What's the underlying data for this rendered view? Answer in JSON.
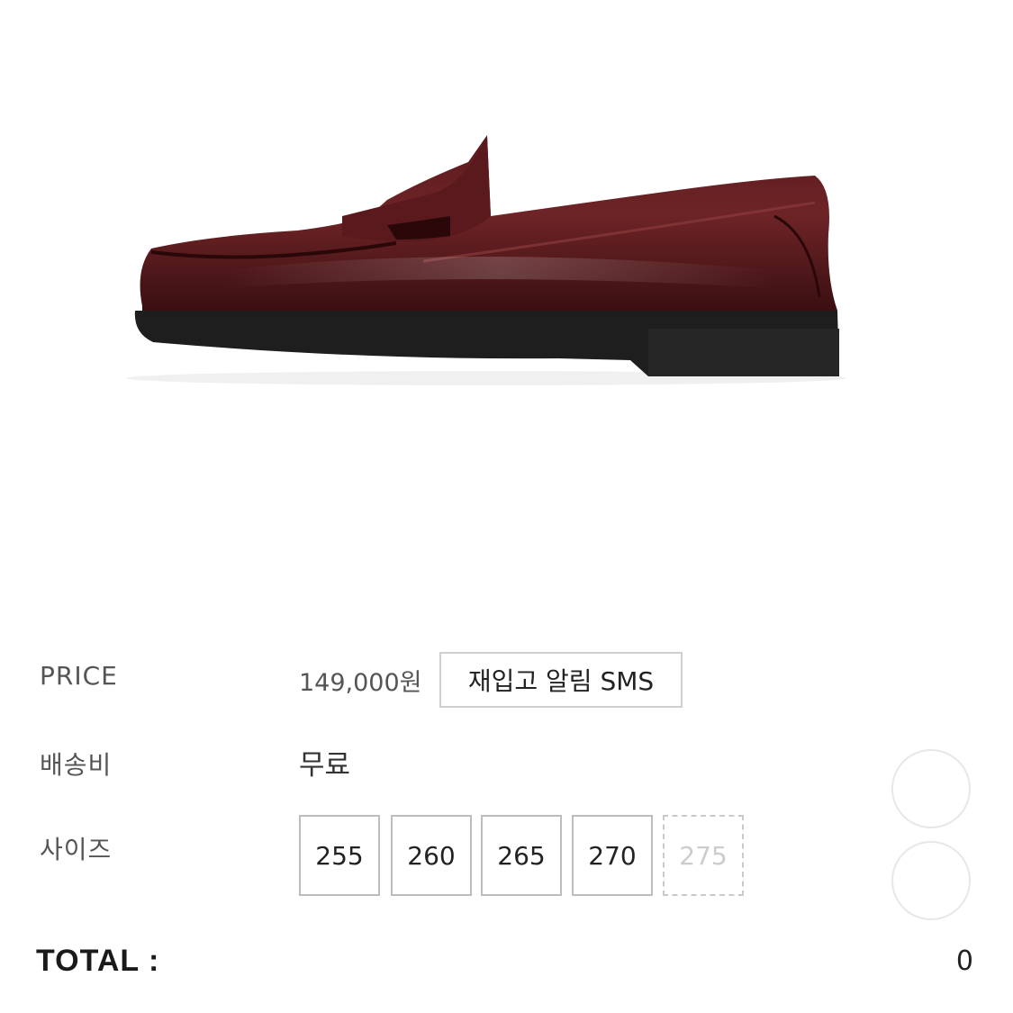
{
  "product": {
    "image_alt": "burgundy-penny-loafer",
    "colors": {
      "leather": "#4a1416",
      "leather_highlight": "#8a3a3c",
      "sole": "#1e1e1e"
    }
  },
  "details": {
    "price_label": "PRICE",
    "price_value": "149,000원",
    "restock_button": "재입고 알림 SMS",
    "shipping_label": "배송비",
    "shipping_value": "무료",
    "size_label": "사이즈"
  },
  "sizes": [
    {
      "label": "255",
      "available": true
    },
    {
      "label": "260",
      "available": true
    },
    {
      "label": "265",
      "available": true
    },
    {
      "label": "270",
      "available": true
    },
    {
      "label": "275",
      "available": false
    }
  ],
  "total": {
    "label": "TOTAL :",
    "value": "0"
  }
}
